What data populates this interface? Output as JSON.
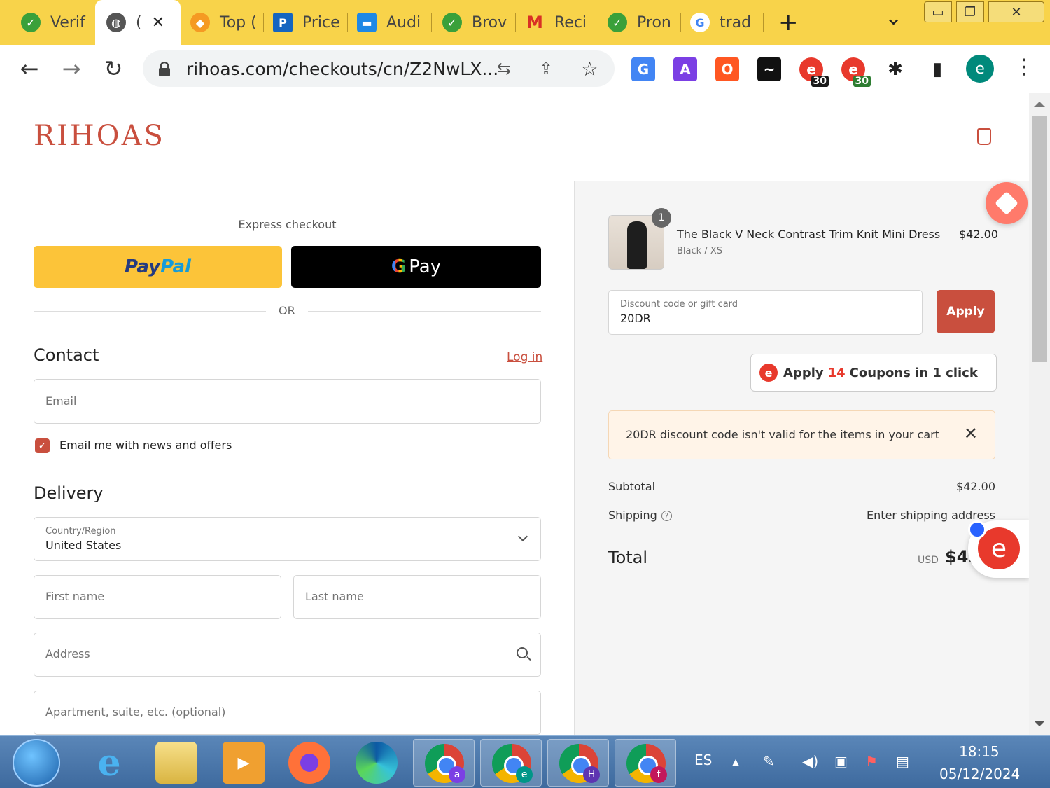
{
  "browser": {
    "tabs": [
      {
        "label": "Verif",
        "icon": "check-leaf-icon",
        "color": "#3aa03a"
      },
      {
        "label": "(",
        "icon": "globe-icon",
        "color": "#555555",
        "active": true
      },
      {
        "label": "Top (",
        "icon": "diamond-icon",
        "color": "#f59a23"
      },
      {
        "label": "Price",
        "icon": "p-logo-icon",
        "color": "#1565c0"
      },
      {
        "label": "Audi",
        "icon": "chat-icon",
        "color": "#1e88e5"
      },
      {
        "label": "Brov",
        "icon": "check-leaf-icon",
        "color": "#3aa03a"
      },
      {
        "label": "Reci",
        "icon": "gmail-icon",
        "color": "#d93025"
      },
      {
        "label": "Pron",
        "icon": "check-leaf-icon",
        "color": "#3aa03a"
      },
      {
        "label": "trad",
        "icon": "google-icon",
        "color": "#4285f4"
      }
    ],
    "close_tab_glyph": "✕",
    "new_tab_glyph": "+",
    "tab_search_glyph": "⌄",
    "window_controls": {
      "minimize": "▭",
      "restore": "❐",
      "close": "✕"
    },
    "nav": {
      "back": "←",
      "forward": "→",
      "reload": "↻"
    },
    "url": "rihoas.com/checkouts/cn/Z2NwLX...",
    "omnibox_icons": {
      "translate": "⇆",
      "share": "⇪",
      "star": "☆"
    },
    "extensions": [
      {
        "icon": "google-translate-icon",
        "glyph": "G",
        "color": "#4285f4"
      },
      {
        "icon": "a-extension-icon",
        "glyph": "A",
        "color": "#7b3fe4"
      },
      {
        "icon": "o-extension-icon",
        "glyph": "O",
        "color": "#ff5722"
      },
      {
        "icon": "wave-extension-icon",
        "glyph": "~",
        "color": "#111111"
      },
      {
        "icon": "coupon-extension-icon",
        "glyph": "e",
        "color": "#e8392c",
        "badge": "30"
      },
      {
        "icon": "coupon-extension-2-icon",
        "glyph": "e",
        "color": "#e8392c",
        "badge": "30"
      },
      {
        "icon": "puzzle-icon",
        "glyph": "✱",
        "color": "#222222"
      },
      {
        "icon": "sidepanel-icon",
        "glyph": "▮",
        "color": "#222222"
      }
    ],
    "profile_letter": "e",
    "menu_glyph": "⋮"
  },
  "store": {
    "logo": "RIHOAS",
    "brand_color": "#c94f3e"
  },
  "checkout": {
    "express_label": "Express checkout",
    "paypal": {
      "pay": "Pay",
      "pal": "Pal"
    },
    "gpay": {
      "g": "G",
      "label": "Pay"
    },
    "or_label": "OR",
    "contact_title": "Contact",
    "login_label": "Log in",
    "email_placeholder": "Email",
    "newsletter_label": "Email me with news and offers",
    "newsletter_checked": true,
    "delivery_title": "Delivery",
    "country_label": "Country/Region",
    "country_value": "United States",
    "first_name_placeholder": "First name",
    "last_name_placeholder": "Last name",
    "address_placeholder": "Address",
    "apartment_placeholder": "Apartment, suite, etc. (optional)"
  },
  "summary": {
    "item": {
      "quantity": "1",
      "name": "The Black V Neck Contrast Trim Knit Mini Dress",
      "variant": "Black / XS",
      "price": "$42.00"
    },
    "discount_label": "Discount code or gift card",
    "discount_value": "20DR",
    "apply_label": "Apply",
    "coupon": {
      "prefix": "Apply",
      "count": "14",
      "suffix": "Coupons in 1 click"
    },
    "error_message": "20DR discount code isn't valid for the items in your cart",
    "error_close": "✕",
    "subtotal_label": "Subtotal",
    "subtotal_value": "$42.00",
    "shipping_label": "Shipping",
    "shipping_help": "?",
    "shipping_value": "Enter shipping address",
    "total_label": "Total",
    "total_currency": "USD",
    "total_value": "$42.00"
  },
  "taskbar": {
    "language": "ES",
    "time": "18:15",
    "date": "05/12/2024",
    "chrome_profiles": [
      {
        "letter": "a",
        "color": "#7b3fe4"
      },
      {
        "letter": "e",
        "color": "#009688"
      },
      {
        "letter": "H",
        "color": "#5e35b1"
      },
      {
        "letter": "f",
        "color": "#c2185b"
      }
    ]
  }
}
